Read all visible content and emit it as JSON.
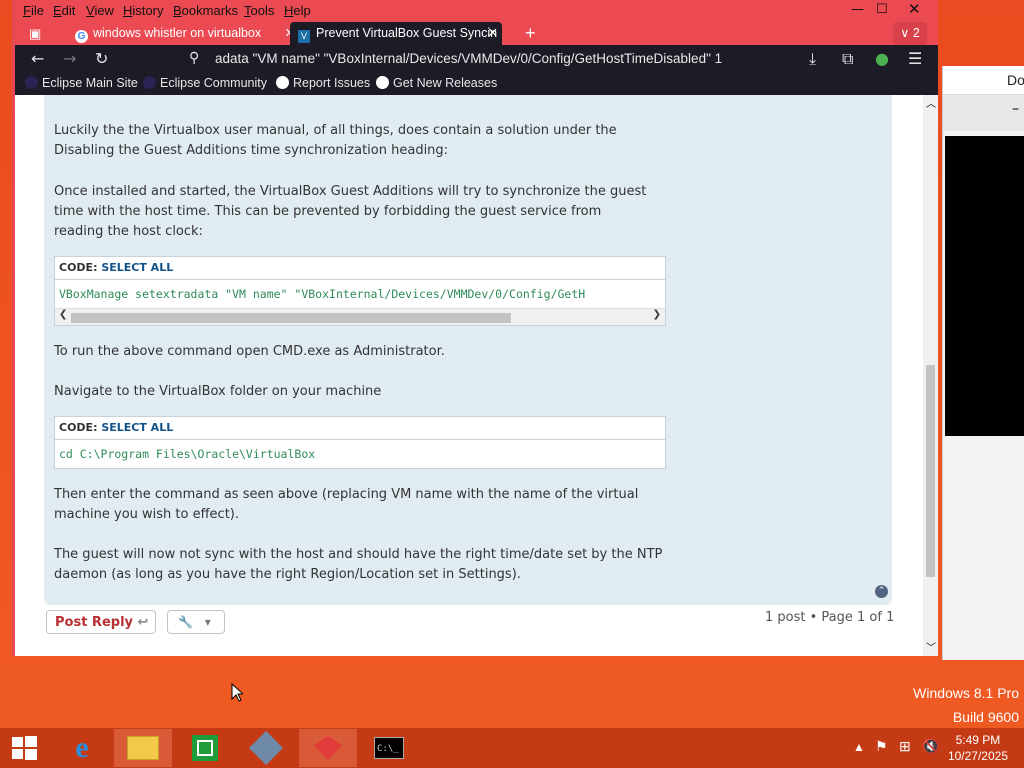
{
  "menu": [
    "File",
    "Edit",
    "View",
    "History",
    "Bookmarks",
    "Tools",
    "Help"
  ],
  "tabs": [
    {
      "label": "windows whistler on virtualbox"
    },
    {
      "label": "Prevent VirtualBox Guest Syncin"
    }
  ],
  "tab_count": "2",
  "url": "adata \"VM name\" \"VBoxInternal/Devices/VMMDev/0/Config/GetHostTimeDisabled\" 1",
  "bookmarks": [
    "Eclipse Main Site",
    "Eclipse Community",
    "Report Issues",
    "Get New Releases"
  ],
  "bg_window_title": "Do",
  "post": {
    "para1": "Luckily the the Virtualbox user manual, of all things, does contain a solution under the Disabling the Guest Additions time synchronization heading:",
    "para2": "Once installed and started, the VirtualBox Guest Additions will try to synchronize the guest time with the host time. This can be prevented by forbidding the guest service from reading the host clock:",
    "code_label": "CODE:",
    "select_all": "SELECT ALL",
    "code1": "VBoxManage setextradata \"VM name\" \"VBoxInternal/Devices/VMMDev/0/Config/GetH",
    "para3": "To run the above command open CMD.exe as Administrator.",
    "para4": "Navigate to the VirtualBox folder on your machine",
    "code2": "cd C:\\Program Files\\Oracle\\VirtualBox",
    "para5": "Then enter the command as seen above (replacing VM name with the name of the virtual machine you wish to effect).",
    "para6": "The guest will now not sync with the host and should have the right time/date set by the NTP daemon (as long as you have the right Region/Location set in Settings)."
  },
  "actions": {
    "post_reply": "Post Reply",
    "pagination": "1 post • Page 1 of 1"
  },
  "desktop": {
    "os_name": "Windows 8.1 Pro",
    "build": "Build 9600"
  },
  "clock": {
    "time": "5:49 PM",
    "date": "10/27/2025"
  }
}
